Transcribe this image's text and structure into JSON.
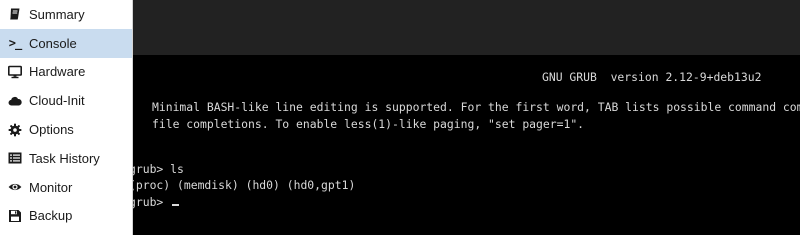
{
  "sidebar": {
    "items": [
      {
        "label": "Summary",
        "icon": "book-icon"
      },
      {
        "label": "Console",
        "icon": "terminal-prompt-icon",
        "active": true
      },
      {
        "label": "Hardware",
        "icon": "monitor-icon"
      },
      {
        "label": "Cloud-Init",
        "icon": "cloud-icon"
      },
      {
        "label": "Options",
        "icon": "gear-icon"
      },
      {
        "label": "Task History",
        "icon": "list-icon"
      },
      {
        "label": "Monitor",
        "icon": "eye-icon"
      },
      {
        "label": "Backup",
        "icon": "floppy-disk-icon"
      }
    ],
    "active_color": "#c9dcef"
  },
  "console": {
    "header": "GNU GRUB  version 2.12-9+deb13u2",
    "intro_line_1": "Minimal BASH-like line editing is supported. For the first word, TAB lists possible command completions.",
    "intro_line_2": "file completions. To enable less(1)-like paging, \"set pager=1\".",
    "prompt_1": "grub> ls",
    "output_1": "(proc) (memdisk) (hd0) (hd0,gpt1)",
    "prompt_2": "grub> ",
    "text_color": "#d9d9d9",
    "background_color": "#000000"
  }
}
